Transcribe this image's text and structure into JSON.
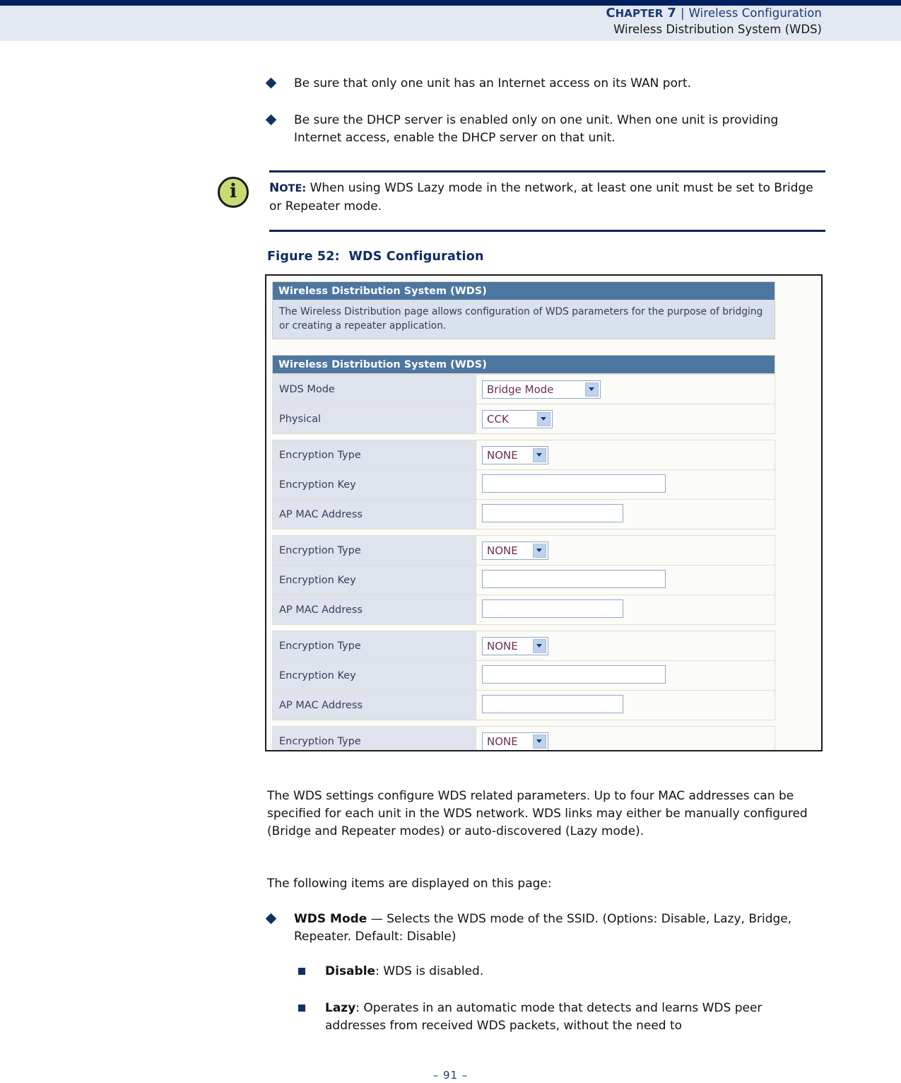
{
  "header": {
    "chapter_label": "Chapter 7",
    "chapter_word_big": "C",
    "chapter_word_rest": "HAPTER",
    "chapter_number": "7",
    "separator": "|",
    "section": "Wireless Configuration",
    "subsection": "Wireless Distribution System (WDS)"
  },
  "intro_bullets": [
    "Be sure that only one unit has an Internet access on its WAN port.",
    "Be sure the DHCP server is enabled only on one unit. When one unit is providing Internet access, enable the DHCP server on that unit."
  ],
  "note": {
    "icon": "info-icon",
    "label_big": "N",
    "label_rest": "OTE:",
    "text": "When using WDS Lazy mode in the network, at least one unit must be set to Bridge or Repeater mode."
  },
  "figure": {
    "caption_prefix": "Figure 52:",
    "caption_title": "WDS Configuration",
    "panel": {
      "title_bar": "Wireless Distribution System (WDS)",
      "description": "The Wireless Distribution page allows configuration of WDS parameters for the purpose of bridging or creating a repeater application.",
      "section_bar": "Wireless Distribution System (WDS)",
      "rows": [
        {
          "label": "WDS Mode",
          "control": "select",
          "value": "Bridge Mode",
          "width": "w-wide"
        },
        {
          "label": "Physical",
          "control": "select",
          "value": "CCK",
          "width": "w-mid"
        },
        {
          "label": "Encryption Type",
          "control": "select",
          "value": "NONE",
          "width": "w-sm"
        },
        {
          "label": "Encryption Key",
          "control": "input",
          "value": "",
          "width": "w-key"
        },
        {
          "label": "AP MAC Address",
          "control": "input",
          "value": "",
          "width": "w-mac"
        },
        {
          "label": "Encryption Type",
          "control": "select",
          "value": "NONE",
          "width": "w-sm"
        },
        {
          "label": "Encryption Key",
          "control": "input",
          "value": "",
          "width": "w-key"
        },
        {
          "label": "AP MAC Address",
          "control": "input",
          "value": "",
          "width": "w-mac"
        },
        {
          "label": "Encryption Type",
          "control": "select",
          "value": "NONE",
          "width": "w-sm"
        },
        {
          "label": "Encryption Key",
          "control": "input",
          "value": "",
          "width": "w-key"
        },
        {
          "label": "AP MAC Address",
          "control": "input",
          "value": "",
          "width": "w-mac"
        },
        {
          "label": "Encryption Type",
          "control": "select",
          "value": "NONE",
          "width": "w-sm"
        }
      ]
    }
  },
  "body": {
    "para1": "The WDS settings configure WDS related parameters. Up to four MAC addresses can be specified for each unit in the WDS network. WDS links may either be manually configured (Bridge and Repeater modes) or auto-discovered (Lazy mode).",
    "para2": "The following items are displayed on this page:"
  },
  "items": {
    "wds_mode_term": "WDS Mode",
    "wds_mode_desc": " — Selects the WDS mode of the SSID. (Options: Disable, Lazy, Bridge, Repeater. Default: Disable)",
    "disable_term": "Disable",
    "disable_desc": ": WDS is disabled.",
    "lazy_term": "Lazy",
    "lazy_desc": ": Operates in an automatic mode that detects and learns WDS peer addresses from received WDS packets, without the need to"
  },
  "footer": {
    "page_number": "–  91  –"
  },
  "colors": {
    "navy_rule": "#002060",
    "header_band": "#e4e8f2",
    "heading_blue": "#0d2b66",
    "bullet_navy": "#123065",
    "ui_bar_blue": "#4d76a0",
    "ui_label_bg": "#dfe3ee",
    "note_icon_green": "#c6dc73"
  }
}
